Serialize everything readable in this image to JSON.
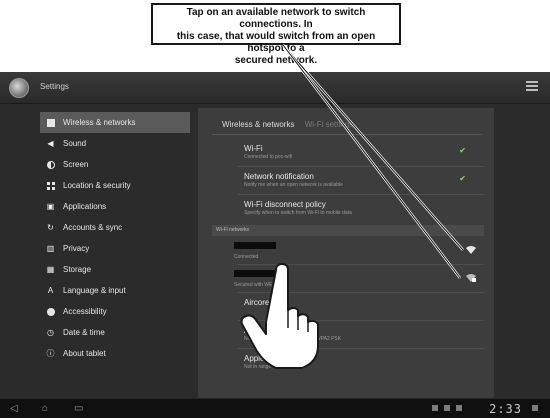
{
  "callout": {
    "line1": "Tap on an available network to switch connections. In",
    "line2": "this case, that would switch from an open hotspot to a",
    "line3": "secured network."
  },
  "tap_label": "Tap",
  "app": {
    "title": "Settings"
  },
  "sidebar": {
    "items": [
      {
        "label": "Wireless & networks",
        "icon": "box-icon",
        "selected": true
      },
      {
        "label": "Sound",
        "icon": "speaker-icon"
      },
      {
        "label": "Screen",
        "icon": "brightness-icon"
      },
      {
        "label": "Location & security",
        "icon": "grid-icon"
      },
      {
        "label": "Applications",
        "icon": "apps-icon"
      },
      {
        "label": "Accounts & sync",
        "icon": "sync-icon"
      },
      {
        "label": "Privacy",
        "icon": "privacy-icon"
      },
      {
        "label": "Storage",
        "icon": "storage-icon"
      },
      {
        "label": "Language & input",
        "icon": "language-icon"
      },
      {
        "label": "Accessibility",
        "icon": "accessibility-icon"
      },
      {
        "label": "Date & time",
        "icon": "clock-icon"
      },
      {
        "label": "About tablet",
        "icon": "info-icon"
      }
    ]
  },
  "panel": {
    "header": "Wireless & networks",
    "header_sub": "Wi-Fi settings",
    "wifi": {
      "title": "Wi-Fi",
      "subtitle": "Connected to poc-wifi",
      "checked": true
    },
    "notification": {
      "title": "Network notification",
      "subtitle": "Notify me when an open network is available",
      "checked": true
    },
    "disconnect": {
      "title": "Wi-Fi disconnect policy",
      "subtitle": "Specify when to switch from Wi-Fi to mobile data"
    },
    "networks_header": "Wi-Fi networks",
    "networks": [
      {
        "name": "",
        "status": "Connected"
      },
      {
        "name": "",
        "status": "Secured with WEP"
      },
      {
        "name": "Aircore",
        "status": ""
      },
      {
        "name": "An",
        "status": "Not in range, secured with WPA/WPA2 PSK"
      },
      {
        "name": "Apple Network 3",
        "status": "Not in range"
      }
    ]
  },
  "navbar": {
    "clock": "2:33"
  }
}
